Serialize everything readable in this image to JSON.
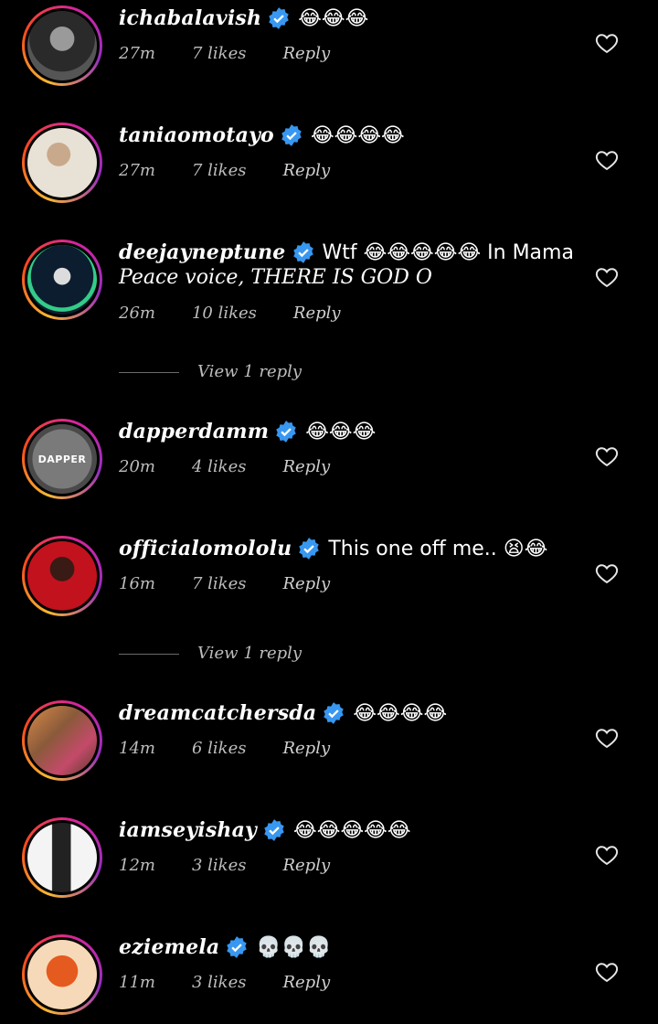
{
  "comments": [
    {
      "username": "ichabalavish",
      "text": "😂😂😂",
      "time": "27m",
      "likes": "7 likes",
      "reply": "Reply",
      "avatar_colors": [
        "#2a2a2a",
        "#888"
      ]
    },
    {
      "username": "taniaomotayo",
      "text": "😂😂😂😂",
      "time": "27m",
      "likes": "7 likes",
      "reply": "Reply",
      "avatar_colors": [
        "#e8e2d6",
        "#c9a98b"
      ]
    },
    {
      "username": "deejayneptune",
      "text": "Wtf 😂😂😂😂😂 In Mama",
      "text2": "Peace voice, THERE IS GOD O",
      "time": "26m",
      "likes": "10 likes",
      "reply": "Reply",
      "avatar_colors": [
        "#0b1d2e",
        "#33cc88"
      ]
    },
    {
      "username": "dapperdamm",
      "text": "😂😂😂",
      "time": "20m",
      "likes": "4 likes",
      "reply": "Reply",
      "avatar_label": "DAPPER",
      "avatar_colors": [
        "#7a7a7a",
        "#4a4a4a"
      ]
    },
    {
      "username": "officialomololu",
      "text": "This one off me.. 😫😂",
      "time": "16m",
      "likes": "7 likes",
      "reply": "Reply",
      "avatar_colors": [
        "#c2121e",
        "#5a0910"
      ]
    },
    {
      "username": "dreamcatchersda",
      "text": "😂😂😂😂",
      "time": "14m",
      "likes": "6 likes",
      "reply": "Reply",
      "avatar_colors": [
        "#8a5a3a",
        "#d98b4a"
      ]
    },
    {
      "username": "iamseyishay",
      "text": "😂😂😂😂😂",
      "time": "12m",
      "likes": "3 likes",
      "reply": "Reply",
      "avatar_colors": [
        "#f4f4f4",
        "#222"
      ]
    },
    {
      "username": "eziemela",
      "text": "💀💀💀",
      "time": "11m",
      "likes": "3 likes",
      "reply": "Reply",
      "avatar_colors": [
        "#e55a1e",
        "#f6d9b8"
      ]
    }
  ],
  "view_replies": [
    "View 1 reply",
    "View 1 reply"
  ],
  "colors": {
    "background": "#000000",
    "verified": "#3897f0",
    "meta": "#bdbdbd"
  }
}
